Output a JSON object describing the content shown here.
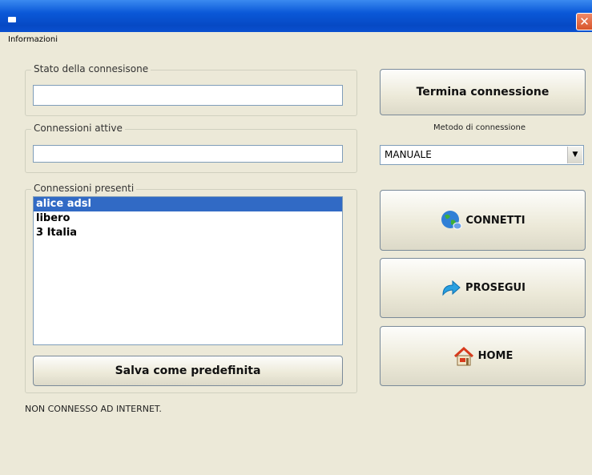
{
  "window": {
    "close_glyph": "✕"
  },
  "menu": {
    "info": "Informazioni"
  },
  "groups": {
    "stato": {
      "label": "Stato della connesisone",
      "value": ""
    },
    "attive": {
      "label": "Connessioni attive",
      "value": ""
    },
    "presenti": {
      "label": "Connessioni presenti",
      "items": [
        {
          "label": "alice adsl",
          "selected": true
        },
        {
          "label": "libero",
          "selected": false
        },
        {
          "label": "3 Italia",
          "selected": false
        }
      ],
      "save_label": "Salva come predefinita"
    }
  },
  "right": {
    "terminate_label": "Termina connessione",
    "method_caption": "Metodo di connessione",
    "method_value": "MANUALE",
    "connect_label": "CONNETTI",
    "continue_label": "PROSEGUI",
    "home_label": "HOME"
  },
  "status": {
    "text": "NON CONNESSO AD INTERNET."
  },
  "icons": {
    "app": "app-icon",
    "close": "close-icon",
    "dropdown": "chevron-down-icon",
    "connect": "globe-icon",
    "continue": "forward-arrow-icon",
    "home": "house-icon"
  },
  "colors": {
    "titlebar": "#0a58d8",
    "selection": "#316ac5",
    "window": "#ece9d8"
  }
}
